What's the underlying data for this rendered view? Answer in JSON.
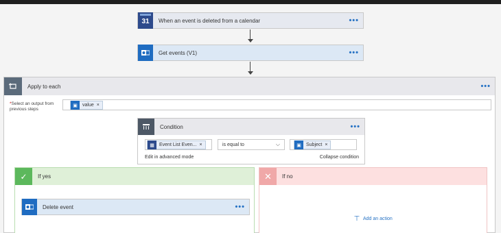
{
  "trigger": {
    "title": "When an event is deleted from a calendar",
    "icon": "calendar-icon",
    "icon_text": "31",
    "color": "#2d4a8c"
  },
  "get_events": {
    "title": "Get events (V1)",
    "icon": "outlook-icon",
    "color": "#1f6cc1"
  },
  "apply_each": {
    "title": "Apply to each",
    "select_label_required": "*",
    "select_label": "Select an output from previous steps",
    "token": {
      "label": "value",
      "remove": "×"
    }
  },
  "condition": {
    "title": "Condition",
    "left_token": {
      "label": "Event List Even...",
      "remove": "×"
    },
    "operator": "is equal to",
    "right_token": {
      "label": "Subject",
      "remove": "×"
    },
    "edit_advanced": "Edit in advanced mode",
    "collapse": "Collapse condition"
  },
  "if_yes": {
    "title": "If yes",
    "action": {
      "title": "Delete event"
    }
  },
  "if_no": {
    "title": "If no",
    "add_action": "Add an action"
  },
  "menu_dots": "•••",
  "colors": {
    "accent": "#2672c4",
    "yes_bg": "#dff0d8",
    "yes_border": "#5cb85c",
    "no_bg": "#fde0e0",
    "no_border": "#e8a0a0"
  }
}
